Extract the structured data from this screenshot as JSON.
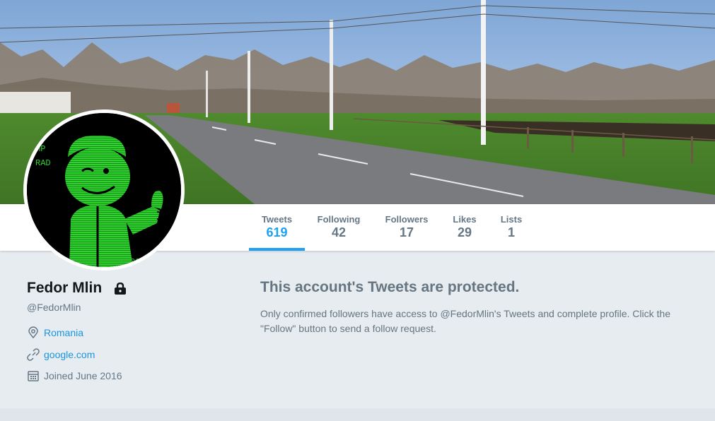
{
  "profile": {
    "name": "Fedor Mlin",
    "handle": "@FedorMlin",
    "location": "Romania",
    "website": "google.com",
    "joined": "Joined June 2016"
  },
  "nav": [
    {
      "label": "Tweets",
      "count": "619",
      "active": true
    },
    {
      "label": "Following",
      "count": "42",
      "active": false
    },
    {
      "label": "Followers",
      "count": "17",
      "active": false
    },
    {
      "label": "Likes",
      "count": "29",
      "active": false
    },
    {
      "label": "Lists",
      "count": "1",
      "active": false
    }
  ],
  "protected": {
    "title": "This account's Tweets are protected.",
    "body": "Only confirmed followers have access to @FedorMlin's Tweets and complete profile. Click the \"Follow\" button to send a follow request."
  },
  "avatar": {
    "text_top": "MP",
    "text_mid": "RAD",
    "text_bottom": "00"
  },
  "icons": {
    "lock": "lock-icon",
    "location": "location-pin-icon",
    "website": "link-icon",
    "joined": "calendar-icon"
  },
  "colors": {
    "accent": "#1da1f2",
    "link": "#1b95e0",
    "muted": "#657786",
    "background": "#e6ecf0"
  }
}
